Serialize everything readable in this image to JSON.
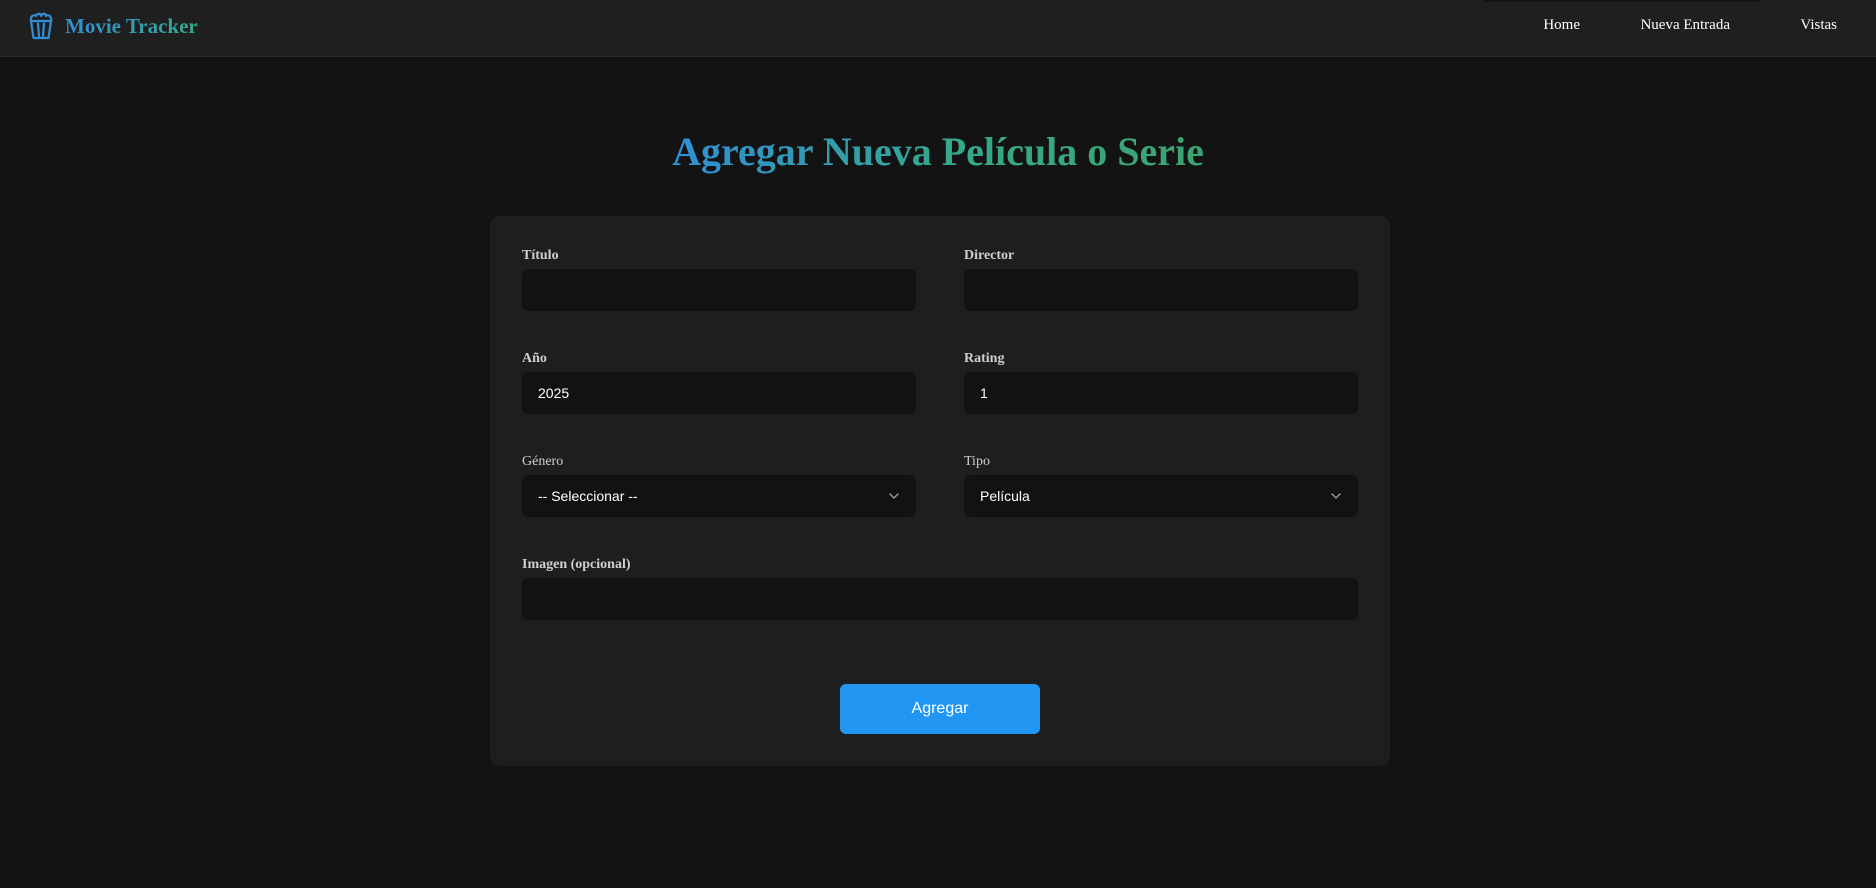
{
  "brand": {
    "name": "Movie Tracker",
    "icon": "popcorn-icon",
    "color": "#2f8fd6"
  },
  "nav": {
    "home": "Home",
    "new_entry": "Nueva Entrada",
    "views": "Vistas"
  },
  "page": {
    "title": "Agregar Nueva Película o Serie"
  },
  "form": {
    "titulo": {
      "label": "Título",
      "value": ""
    },
    "director": {
      "label": "Director",
      "value": ""
    },
    "anio": {
      "label": "Año",
      "value": "2025"
    },
    "rating": {
      "label": "Rating",
      "value": "1"
    },
    "genero": {
      "label": "Género",
      "selected": "-- Seleccionar --"
    },
    "tipo": {
      "label": "Tipo",
      "selected": "Película"
    },
    "imagen": {
      "label": "Imagen (opcional)",
      "value": ""
    },
    "submit_label": "Agregar"
  },
  "colors": {
    "background": "#131313",
    "navbar": "#1f1f1f",
    "card": "#1e1e1e",
    "input": "#121212",
    "accent": "#2196f3",
    "gradient_start": "#2f8fd6",
    "gradient_end": "#36a98a"
  }
}
